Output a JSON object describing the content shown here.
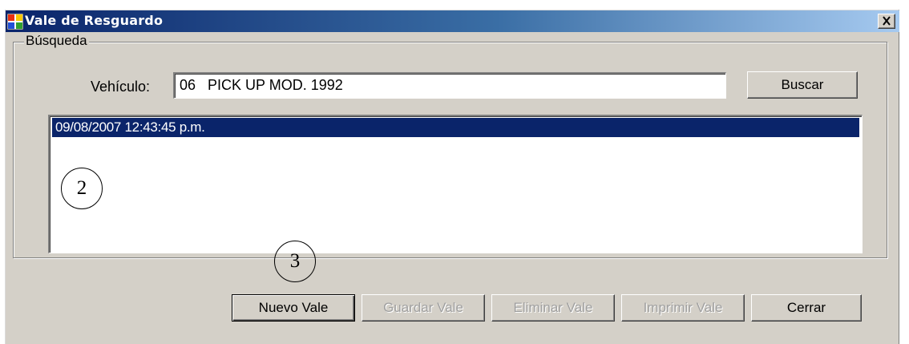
{
  "window": {
    "title": "Vale de Resguardo",
    "close_symbol": "✕"
  },
  "search": {
    "group_label": "Búsqueda",
    "vehicle_label": "Vehículo:",
    "vehicle_value": "06   PICK UP MOD. 1992",
    "search_button": "Buscar"
  },
  "results": {
    "items": [
      "09/08/2007 12:43:45 p.m."
    ],
    "selected_index": 0
  },
  "callouts": [
    "2",
    "3"
  ],
  "actions": {
    "new": "Nuevo Vale",
    "save": "Guardar Vale",
    "delete": "Eliminar Vale",
    "print": "Imprimir Vale",
    "close": "Cerrar"
  },
  "colors": {
    "titlebar_start": "#0a246a",
    "titlebar_end": "#a6caf0",
    "face": "#d4d0c8",
    "selection": "#0a246a"
  }
}
